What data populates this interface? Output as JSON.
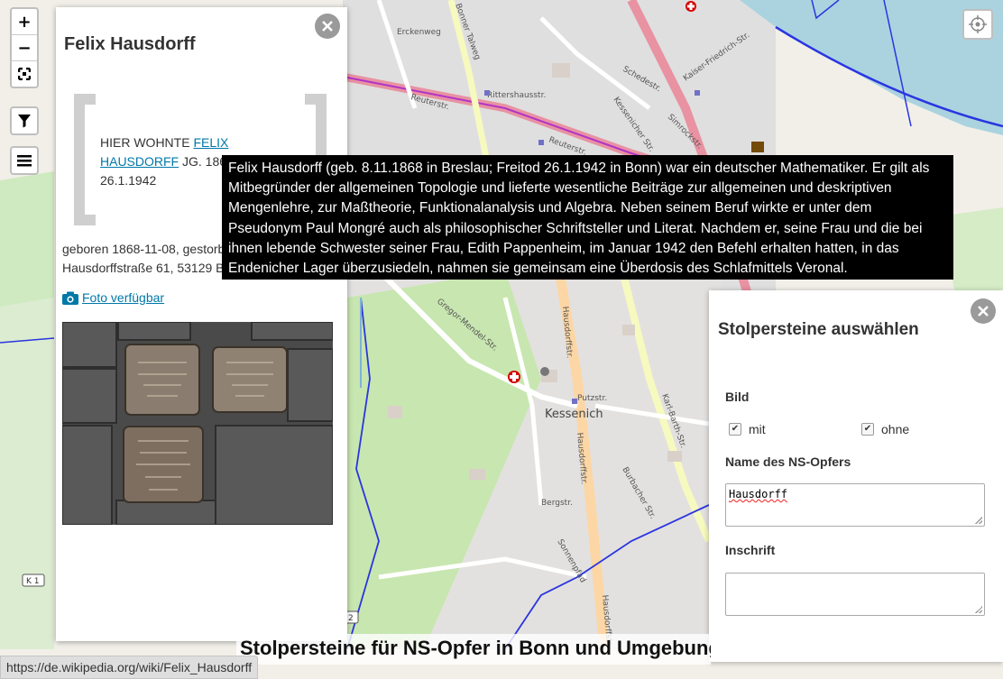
{
  "map": {
    "place_label": "Kessenich",
    "street_labels": [
      "Reuterstr.",
      "Reuterstr.",
      "Hausdorffstr.",
      "Hausdorffstr.",
      "Hausdorffstr.",
      "Putzstr.",
      "Kaiser-Friedrich-Str.",
      "Bonner Talweg",
      "Gregor-Mendel-Str.",
      "Karl-Barth-Str.",
      "Sonnenpfad",
      "Bergstr.",
      "Rittershausstr.",
      "Simrockstr.",
      "Burbacher Str.",
      "Erckenweg",
      "Schedestr.",
      "Kessenicher Str."
    ],
    "road_ref": "K 1",
    "road_ref_small": "2"
  },
  "controls": {
    "zoom_in": "+",
    "zoom_out": "−"
  },
  "person_popup": {
    "name": "Felix Hausdorff",
    "inscription_prefix": "HIER WOHNTE",
    "inscription_link": "FELIX HAUSDORFF",
    "inscription_suffix": "JG. 1868",
    "inscription_date": "26.1.1942",
    "birth_info_line1": "geboren 1868-11-08, gestorben 1942-01-26",
    "birth_info_line2": "Hausdorffstraße 61, 53129 Bonn",
    "photo_link": "Foto verfügbar"
  },
  "tooltip": {
    "text": "Felix Hausdorff (geb. 8.11.1868 in Breslau; Freitod 26.1.1942 in Bonn) war ein deutscher Mathematiker. Er gilt als Mitbegründer der allgemeinen Topologie und lieferte wesentliche Beiträge zur allgemeinen und deskriptiven Mengenlehre, zur Maßtheorie, Funktionalanalysis und Algebra. Neben seinem Beruf wirkte er unter dem Pseudonym Paul Mongré auch als philosophischer Schriftsteller und Literat. Nachdem er, seine Frau und die bei ihnen lebende Schwester seiner Frau, Edith Pappenheim, im Januar 1942 den Befehl erhalten hatten, in das Endenicher Lager überzusiedeln, nahmen sie gemeinsam eine Überdosis des Schlafmittels Veronal."
  },
  "filter_panel": {
    "title": "Stolpersteine auswählen",
    "bild_label": "Bild",
    "mit_label": "mit",
    "ohne_label": "ohne",
    "mit_checked": true,
    "ohne_checked": true,
    "name_label": "Name des NS-Opfers",
    "name_value": "Hausdorff",
    "inschrift_label": "Inschrift",
    "inschrift_value": ""
  },
  "map_title": "Stolpersteine für NS-Opfer in Bonn und Umgebung",
  "status_url": "https://de.wikipedia.org/wiki/Felix_Hausdorff"
}
